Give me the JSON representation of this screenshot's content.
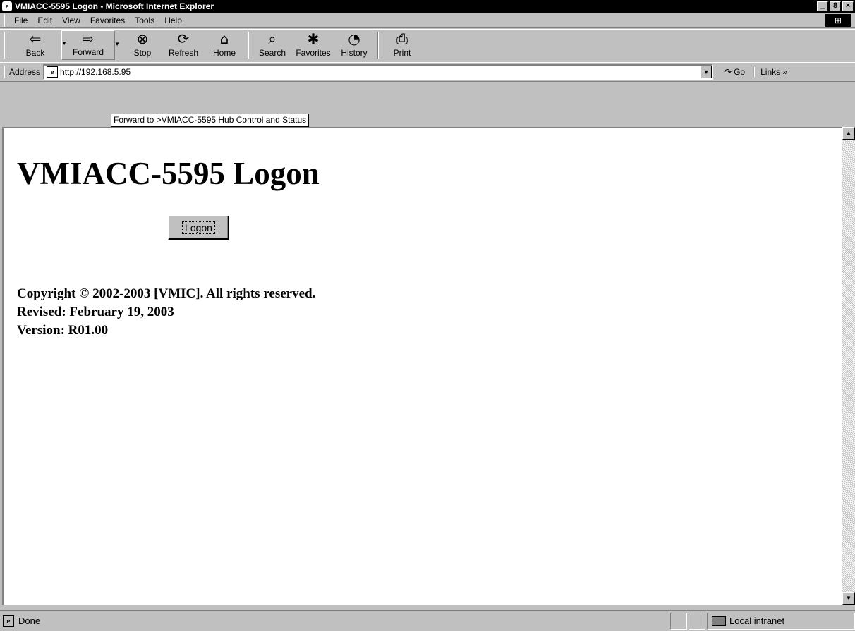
{
  "window": {
    "title": "VMIACC-5595 Logon - Microsoft Internet Explorer",
    "controls": [
      "_",
      "8",
      "×"
    ]
  },
  "menu": {
    "items": [
      "File",
      "Edit",
      "View",
      "Favorites",
      "Tools",
      "Help"
    ]
  },
  "toolbar": {
    "back": "Back",
    "forward": "Forward",
    "stop": "Stop",
    "refresh": "Refresh",
    "home": "Home",
    "search": "Search",
    "favorites": "Favorites",
    "history": "History",
    "print": "Print"
  },
  "address": {
    "label": "Address",
    "url": "http://192.168.5.95",
    "tooltip": "Forward to >VMIACC-5595 Hub Control and Status",
    "go": "Go",
    "links": "Links »"
  },
  "page": {
    "heading": "VMIACC-5595 Logon",
    "logon_button": "Logon",
    "copyright": "Copyright © 2002-2003 [VMIC]. All rights reserved.",
    "revised": "Revised: February 19, 2003",
    "version": "Version: R01.00"
  },
  "status": {
    "text": "Done",
    "zone": "Local intranet"
  }
}
